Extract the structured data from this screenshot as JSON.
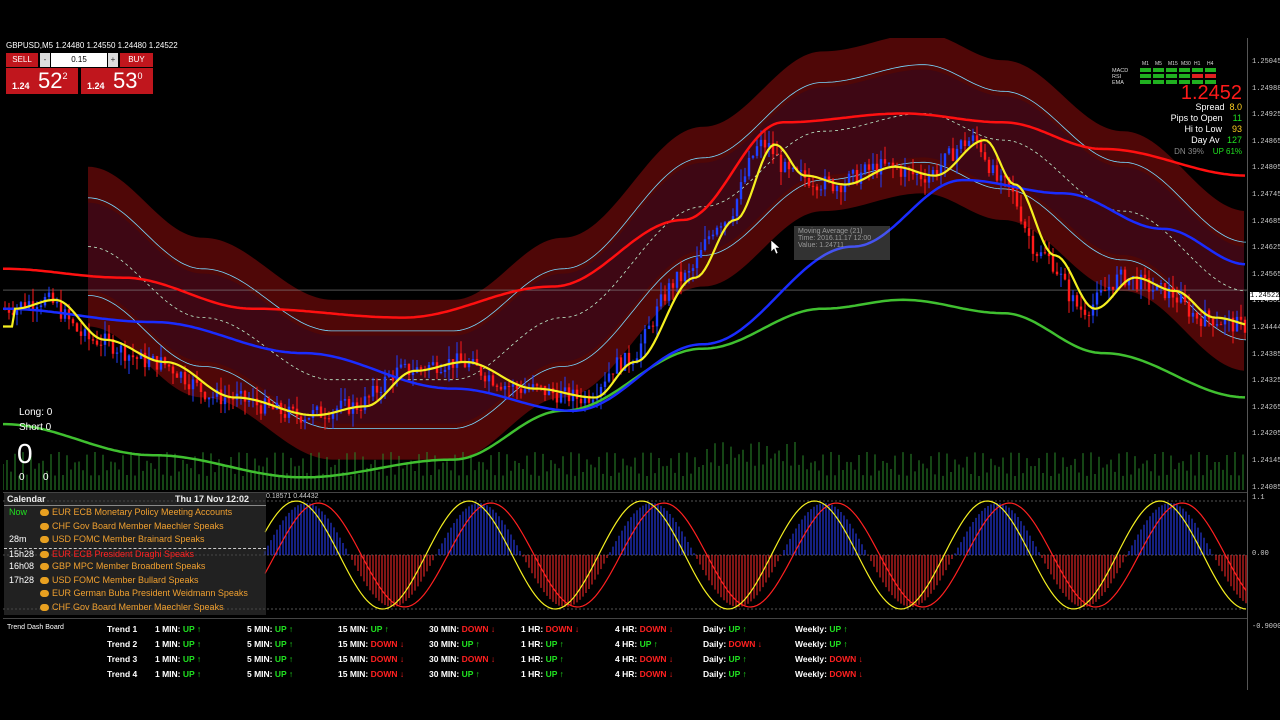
{
  "chart": {
    "title": "GBPUSD,M5  1.24480 1.24550 1.24480 1.24522",
    "price_labels": [
      "1.25045",
      "1.24988",
      "1.24925",
      "1.24865",
      "1.24805",
      "1.24745",
      "1.24685",
      "1.24625",
      "1.24565",
      "1.24505",
      "1.24444",
      "1.24385",
      "1.24325",
      "1.24265",
      "1.24205",
      "1.24145",
      "1.24085"
    ],
    "current_price_tag": "1.24522",
    "osc_axis": [
      "1.1",
      "0.00",
      "-0.9000000"
    ],
    "osc_header": "0.18571 0.44432"
  },
  "trade": {
    "sell_label": "SELL",
    "buy_label": "BUY",
    "lot": "0.15",
    "sell_small": "1.24",
    "sell_big": "52",
    "sell_sup": "2",
    "buy_small": "1.24",
    "buy_big": "53",
    "buy_sup": "0"
  },
  "tooltip": {
    "line1": "Moving Average (21)",
    "line2": "Time: 2016.11.17 12:00",
    "line3": "Value: 1.24711"
  },
  "info": {
    "indicators": [
      "MACD",
      "RSI",
      "EMA"
    ],
    "timeframes": [
      "M1",
      "M5",
      "M15",
      "M30",
      "H1",
      "H4"
    ],
    "price": "1.2452",
    "spread_label": "Spread",
    "spread_value": "8.0",
    "pips_label": "Pips to Open",
    "pips_value": "11",
    "hilow_label": "Hi to Low",
    "hilow_value": "93",
    "dayav_label": "Day Av",
    "dayav_value": "127",
    "dn_label": "DN 39%",
    "up_label": "UP 61%"
  },
  "positions": {
    "long_label": "Long:  0",
    "short_label": "Short  0",
    "big_zero": "0",
    "z1": "0",
    "z2": "0"
  },
  "calendar": {
    "title": "Calendar",
    "date": "Thu 17 Nov 12:02",
    "rows": [
      {
        "time": "Now",
        "event": "EUR ECB Monetary Policy Meeting Accounts",
        "color": "#f0a030"
      },
      {
        "time": "",
        "event": "CHF  Gov Board Member Maechler Speaks",
        "color": "#f0a030"
      },
      {
        "time": "28m",
        "event": "USD  FOMC Member Brainard Speaks",
        "color": "#f0a030"
      },
      {
        "time": "15h28",
        "event": "EUR  ECB President Draghi Speaks",
        "color": "#ff2020"
      },
      {
        "time": "16h08",
        "event": "GBP  MPC Member Broadbent Speaks",
        "color": "#f0a030"
      },
      {
        "time": "17h28",
        "event": "USD  FOMC Member Bullard Speaks",
        "color": "#f0a030"
      },
      {
        "time": "",
        "event": "EUR German Buba President Weidmann Speaks",
        "color": "#f0a030"
      },
      {
        "time": "",
        "event": "CHF  Gov Board Member Maechler Speaks",
        "color": "#f0a030"
      }
    ]
  },
  "dashboard": {
    "title": "Trend Dash Board",
    "rows": [
      {
        "name": "Trend 1",
        "cells": [
          [
            "1 MIN:",
            "UP",
            "↑"
          ],
          [
            "5 MIN:",
            "UP",
            "↑"
          ],
          [
            "15 MIN:",
            "UP",
            "↑"
          ],
          [
            "30 MIN:",
            "DOWN",
            "↓"
          ],
          [
            "1 HR:",
            "DOWN",
            "↓"
          ],
          [
            "4 HR:",
            "DOWN",
            "↓"
          ],
          [
            "Daily:",
            "UP",
            "↑"
          ],
          [
            "Weekly:",
            "UP",
            "↑"
          ]
        ]
      },
      {
        "name": "Trend 2",
        "cells": [
          [
            "1 MIN:",
            "UP",
            "↑"
          ],
          [
            "5 MIN:",
            "UP",
            "↑"
          ],
          [
            "15 MIN:",
            "DOWN",
            "↓"
          ],
          [
            "30 MIN:",
            "UP",
            "↑"
          ],
          [
            "1 HR:",
            "UP",
            "↑"
          ],
          [
            "4 HR:",
            "UP",
            "↑"
          ],
          [
            "Daily:",
            "DOWN",
            "↓"
          ],
          [
            "Weekly:",
            "UP",
            "↑"
          ]
        ]
      },
      {
        "name": "Trend 3",
        "cells": [
          [
            "1 MIN:",
            "UP",
            "↑"
          ],
          [
            "5 MIN:",
            "UP",
            "↑"
          ],
          [
            "15 MIN:",
            "DOWN",
            "↓"
          ],
          [
            "30 MIN:",
            "DOWN",
            "↓"
          ],
          [
            "1 HR:",
            "UP",
            "↑"
          ],
          [
            "4 HR:",
            "DOWN",
            "↓"
          ],
          [
            "Daily:",
            "UP",
            "↑"
          ],
          [
            "Weekly:",
            "DOWN",
            "↓"
          ]
        ]
      },
      {
        "name": "Trend 4",
        "cells": [
          [
            "1 MIN:",
            "UP",
            "↑"
          ],
          [
            "5 MIN:",
            "UP",
            "↑"
          ],
          [
            "15 MIN:",
            "DOWN",
            "↓"
          ],
          [
            "30 MIN:",
            "UP",
            "↑"
          ],
          [
            "1 HR:",
            "UP",
            "↑"
          ],
          [
            "4 HR:",
            "DOWN",
            "↓"
          ],
          [
            "Daily:",
            "UP",
            "↑"
          ],
          [
            "Weekly:",
            "DOWN",
            "↓"
          ]
        ]
      }
    ]
  },
  "colors": {
    "up": "#20e020",
    "down": "#ff2020",
    "ema_red": "#ff1010",
    "ema_yellow": "#f5f020",
    "ema_blue": "#1a2cff",
    "ema_green": "#40c030",
    "band": "#6a0a0a"
  }
}
